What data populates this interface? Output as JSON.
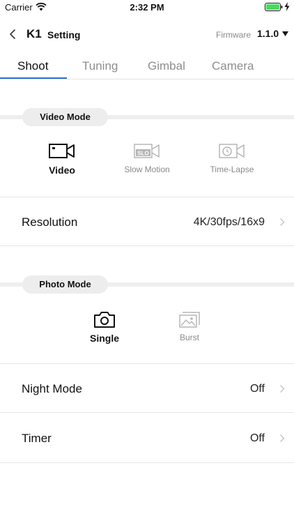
{
  "status_bar": {
    "carrier": "Carrier",
    "time": "2:32 PM"
  },
  "nav": {
    "model": "K1",
    "title": "Setting",
    "firmware_label": "Firmware",
    "firmware_version": "1.1.0"
  },
  "tabs": [
    {
      "label": "Shoot",
      "active": true
    },
    {
      "label": "Tuning",
      "active": false
    },
    {
      "label": "Gimbal",
      "active": false
    },
    {
      "label": "Camera",
      "active": false
    }
  ],
  "video_section": {
    "title": "Video Mode",
    "modes": [
      {
        "label": "Video",
        "icon": "video-camera-icon",
        "active": true
      },
      {
        "label": "Slow Motion",
        "icon": "slow-motion-icon",
        "icon_text": "SLO",
        "active": false
      },
      {
        "label": "Time-Lapse",
        "icon": "time-lapse-icon",
        "active": false
      }
    ],
    "resolution": {
      "label": "Resolution",
      "value": "4K/30fps/16x9"
    }
  },
  "photo_section": {
    "title": "Photo Mode",
    "modes": [
      {
        "label": "Single",
        "icon": "photo-camera-icon",
        "active": true
      },
      {
        "label": "Burst",
        "icon": "burst-icon",
        "active": false
      }
    ]
  },
  "settings": [
    {
      "label": "Night Mode",
      "value": "Off"
    },
    {
      "label": "Timer",
      "value": "Off"
    }
  ],
  "colors": {
    "accent": "#2a6fd9",
    "battery": "#4cd964",
    "inactive": "#8e8e8e"
  }
}
